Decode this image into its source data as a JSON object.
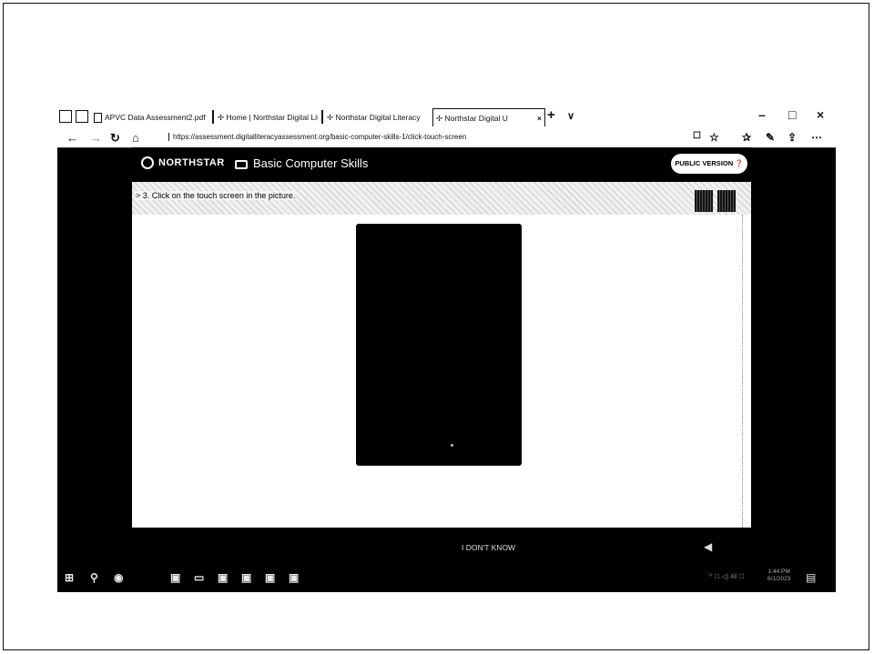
{
  "browser": {
    "tabs": [
      {
        "label": "APVC Data Assessment2.pdf",
        "active": false
      },
      {
        "label": "Home | Northstar Digital Lit",
        "active": false
      },
      {
        "label": "Northstar Digital Literacy",
        "active": false
      },
      {
        "label": "Northstar Digital U",
        "active": true
      }
    ],
    "new_tab_glyph": "+",
    "tab_list_glyph": "∨",
    "window_controls": [
      "–",
      "□",
      "×"
    ],
    "url": "https://assessment.digitalliteracyassessment.org/basic-computer-skills-1/click-touch-screen",
    "nav": {
      "back": "←",
      "forward": "→",
      "refresh": "↻",
      "home": "⌂"
    }
  },
  "header": {
    "brand": "NORTHSTAR",
    "course": "Basic Computer Skills",
    "public_version": "PUBLIC VERSION"
  },
  "question": {
    "text": "3. Click on the touch screen in the picture."
  },
  "footer": {
    "i_dont_know": "I DON'T KNOW"
  },
  "taskbar": {
    "tray": "^ ☐ ◁) 4ⅱ ☐",
    "clock_time": "1:44 PM",
    "clock_date": "6/1/2023"
  },
  "colors": {
    "page_bg": "#000000",
    "content_bg": "#ffffff",
    "pill_bg": "#ffffff"
  }
}
